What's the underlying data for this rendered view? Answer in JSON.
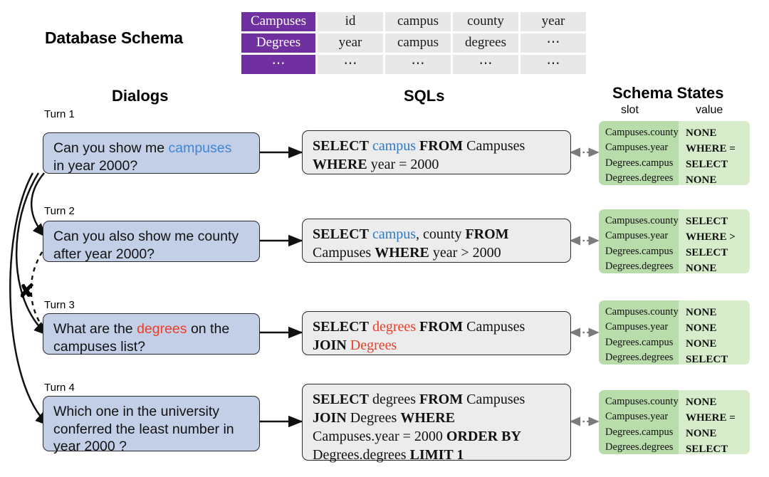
{
  "headings": {
    "database_schema": "Database Schema",
    "dialogs": "Dialogs",
    "sqls": "SQLs",
    "schema_states": "Schema States",
    "slot_column": "slot",
    "value_column": "value"
  },
  "schema_table": {
    "rows": [
      {
        "table": "Campuses",
        "columns": [
          "id",
          "campus",
          "county",
          "year"
        ]
      },
      {
        "table": "Degrees",
        "columns": [
          "year",
          "campus",
          "degrees",
          "⋯"
        ]
      },
      {
        "table": "⋯",
        "columns": [
          "⋯",
          "⋯",
          "⋯",
          "⋯"
        ]
      }
    ]
  },
  "turns": [
    {
      "label": "Turn 1",
      "dialog": {
        "lines": [
          [
            {
              "t": "Can you show me ",
              "c": "plain"
            },
            {
              "t": "campuses",
              "c": "blue"
            }
          ],
          [
            {
              "t": "in year 2000?",
              "c": "plain"
            }
          ]
        ]
      },
      "sql": {
        "lines": [
          [
            {
              "t": "SELECT",
              "c": "kw"
            },
            {
              "t": " ",
              "c": "plain"
            },
            {
              "t": "campus",
              "c": "blue"
            },
            {
              "t": " ",
              "c": "plain"
            },
            {
              "t": "FROM",
              "c": "kw"
            },
            {
              "t": " Campuses",
              "c": "plain"
            }
          ],
          [
            {
              "t": "WHERE",
              "c": "kw"
            },
            {
              "t": " year = 2000",
              "c": "plain"
            }
          ]
        ]
      },
      "state": {
        "slots": [
          "Campuses.county",
          "Campuses.year",
          "Degrees.campus",
          "Degrees.degrees",
          "......"
        ],
        "values": [
          "NONE",
          "WHERE =",
          "SELECT",
          "NONE",
          "......"
        ]
      }
    },
    {
      "label": "Turn 2",
      "dialog": {
        "lines": [
          [
            {
              "t": "Can you also show me county",
              "c": "plain"
            }
          ],
          [
            {
              "t": "after year 2000?",
              "c": "plain"
            }
          ]
        ]
      },
      "sql": {
        "lines": [
          [
            {
              "t": "SELECT",
              "c": "kw"
            },
            {
              "t": " ",
              "c": "plain"
            },
            {
              "t": "campus",
              "c": "blue"
            },
            {
              "t": ", county ",
              "c": "plain"
            },
            {
              "t": "FROM",
              "c": "kw"
            }
          ],
          [
            {
              "t": "Campuses ",
              "c": "plain"
            },
            {
              "t": "WHERE",
              "c": "kw"
            },
            {
              "t": " year > 2000",
              "c": "plain"
            }
          ]
        ]
      },
      "state": {
        "slots": [
          "Campuses.county",
          "Campuses.year",
          "Degrees.campus",
          "Degrees.degrees",
          "......"
        ],
        "values": [
          "SELECT",
          "WHERE >",
          "SELECT",
          "NONE",
          "......"
        ]
      }
    },
    {
      "label": "Turn 3",
      "dialog": {
        "lines": [
          [
            {
              "t": "What are the ",
              "c": "plain"
            },
            {
              "t": "degrees",
              "c": "red"
            },
            {
              "t": " on the",
              "c": "plain"
            }
          ],
          [
            {
              "t": "campuses list?",
              "c": "plain"
            }
          ]
        ]
      },
      "sql": {
        "lines": [
          [
            {
              "t": "SELECT",
              "c": "kw"
            },
            {
              "t": " ",
              "c": "plain"
            },
            {
              "t": "degrees",
              "c": "red"
            },
            {
              "t": " ",
              "c": "plain"
            },
            {
              "t": "FROM",
              "c": "kw"
            },
            {
              "t": " Campuses",
              "c": "plain"
            }
          ],
          [
            {
              "t": "JOIN",
              "c": "kw"
            },
            {
              "t": " ",
              "c": "plain"
            },
            {
              "t": "Degrees",
              "c": "red"
            }
          ]
        ]
      },
      "state": {
        "slots": [
          "Campuses.county",
          "Campuses.year",
          "Degrees.campus",
          "Degrees.degrees",
          "......"
        ],
        "values": [
          "NONE",
          "NONE",
          "NONE",
          "SELECT",
          "......"
        ]
      }
    },
    {
      "label": "Turn 4",
      "dialog": {
        "lines": [
          [
            {
              "t": "Which one in the university",
              "c": "plain"
            }
          ],
          [
            {
              "t": "conferred the least number in",
              "c": "plain"
            }
          ],
          [
            {
              "t": "year 2000 ?",
              "c": "plain"
            }
          ]
        ]
      },
      "sql": {
        "lines": [
          [
            {
              "t": "SELECT",
              "c": "kw"
            },
            {
              "t": " degrees ",
              "c": "plain"
            },
            {
              "t": "FROM",
              "c": "kw"
            },
            {
              "t": " Campuses",
              "c": "plain"
            }
          ],
          [
            {
              "t": "JOIN",
              "c": "kw"
            },
            {
              "t": " Degrees ",
              "c": "plain"
            },
            {
              "t": "WHERE",
              "c": "kw"
            }
          ],
          [
            {
              "t": "Campuses.year = 2000 ",
              "c": "plain"
            },
            {
              "t": "ORDER BY",
              "c": "kw"
            }
          ],
          [
            {
              "t": "Degrees.degrees ",
              "c": "plain"
            },
            {
              "t": "LIMIT 1",
              "c": "kw"
            }
          ]
        ]
      },
      "state": {
        "slots": [
          "Campuses.county",
          "Campuses.year",
          "Degrees.campus",
          "Degrees.degrees",
          "......"
        ],
        "values": [
          "NONE",
          "WHERE =",
          "NONE",
          "SELECT",
          "......"
        ]
      }
    }
  ],
  "annotations": {
    "cross_mark": "✘"
  },
  "colors": {
    "table_header_purple": "#7030a0",
    "dialog_blue": "#c3cfe7",
    "sql_gray": "#ececec",
    "state_slot_green": "#b9dcab",
    "state_value_green": "#d6ecca",
    "highlight_blue": "#3f86d4",
    "highlight_red": "#e8402a"
  }
}
